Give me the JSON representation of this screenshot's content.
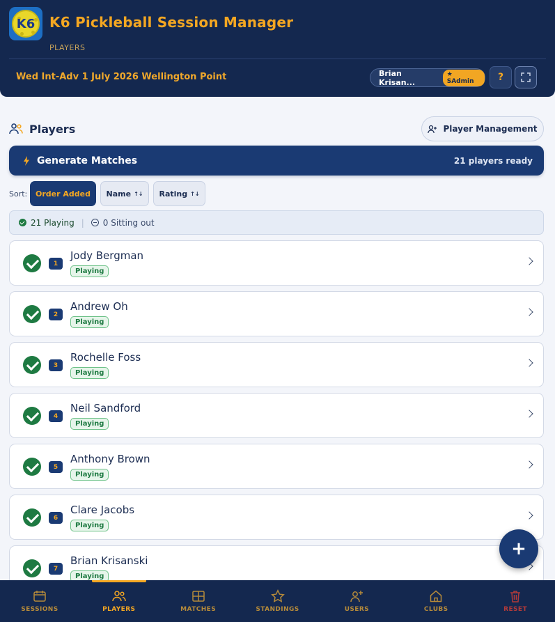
{
  "header": {
    "app_title": "K6 Pickleball Session Manager",
    "logo_text": "K6",
    "page_subtitle": "PLAYERS",
    "session_name": "Wed Int-Adv 1 July 2026 Wellington Point",
    "user_name": "Brian Krisan...",
    "user_role": "★ SAdmin",
    "help_label": "?"
  },
  "players_section": {
    "title": "Players",
    "player_management_label": "Player Management"
  },
  "generate": {
    "label": "Generate Matches",
    "ready_text": "21 players ready"
  },
  "sort": {
    "label": "Sort:",
    "options": [
      {
        "label": "Order Added",
        "active": true
      },
      {
        "label": "Name",
        "arrow": "↑↓"
      },
      {
        "label": "Rating",
        "arrow": "↑↓"
      }
    ]
  },
  "summary": {
    "playing_count": "21",
    "playing_label": "Playing",
    "sep": "|",
    "sitting_count": "0",
    "sitting_label": "Sitting out"
  },
  "players": [
    {
      "num": "1",
      "name": "Jody Bergman",
      "status": "Playing"
    },
    {
      "num": "2",
      "name": "Andrew Oh",
      "status": "Playing"
    },
    {
      "num": "3",
      "name": "Rochelle Foss",
      "status": "Playing"
    },
    {
      "num": "4",
      "name": "Neil Sandford",
      "status": "Playing"
    },
    {
      "num": "5",
      "name": "Anthony Brown",
      "status": "Playing"
    },
    {
      "num": "6",
      "name": "Clare Jacobs",
      "status": "Playing"
    },
    {
      "num": "7",
      "name": "Brian Krisanski",
      "status": "Playing"
    }
  ],
  "fab_label": "+",
  "nav": [
    {
      "label": "SESSIONS",
      "icon": "calendar-icon"
    },
    {
      "label": "PLAYERS",
      "icon": "people-icon",
      "active": true
    },
    {
      "label": "MATCHES",
      "icon": "grid-icon"
    },
    {
      "label": "STANDINGS",
      "icon": "star-icon"
    },
    {
      "label": "USERS",
      "icon": "user-plus-icon"
    },
    {
      "label": "CLUBS",
      "icon": "home-icon"
    },
    {
      "label": "RESET",
      "icon": "trash-icon"
    }
  ],
  "colors": {
    "navy": "#14284f",
    "accent": "#f4a722",
    "playing_green": "#1e7a42",
    "reset_red": "#b23a3a"
  }
}
